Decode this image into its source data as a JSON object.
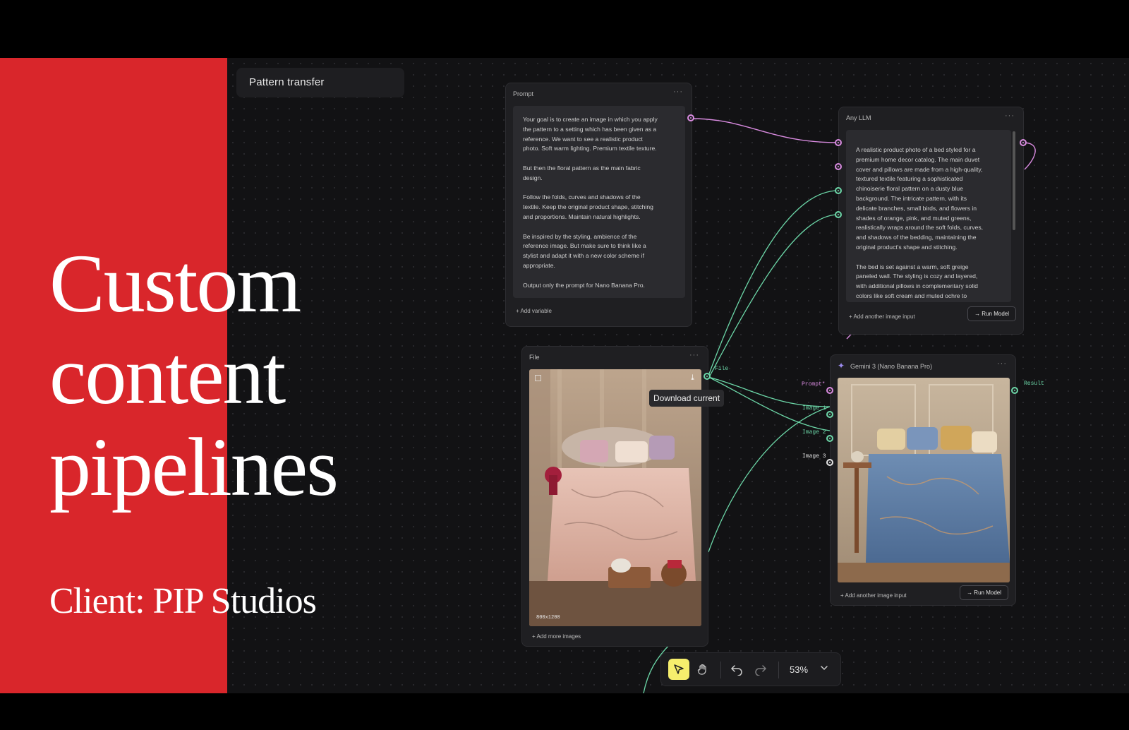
{
  "slide": {
    "headline": "Custom\ncontent\npipelines",
    "client": "Client: PIP Studios"
  },
  "workflow_title": "Pattern transfer",
  "prompt_node": {
    "title": "Prompt",
    "menu": "···",
    "text": "Your goal is to create an image in which you apply\nthe pattern to a setting which has been given as a\nreference. We want to see a realistic product\nphoto. Soft warm lighting. Premium textile texture.\n\nBut then the  floral pattern as the main fabric\ndesign.\n\nFollow the folds, curves and shadows of the\ntextile. Keep the original product shape, stitching\nand proportions. Maintain natural highlights.\n\nBe inspired by the styling, ambience of the\nreference image. But make sure to think like a\nstylist and adapt it with a new color scheme if\nappropriate.\n\nOutput only the prompt for Nano Banana Pro.",
    "footer": "+ Add variable"
  },
  "llm_node": {
    "title": "Any LLM",
    "menu": "···",
    "text": "A realistic product photo of a bed styled for a\npremium home decor catalog. The main duvet\ncover and pillows are made from a high-quality,\ntextured textile featuring a sophisticated\nchinoiserie floral pattern on a dusty blue\nbackground. The intricate pattern, with its\ndelicate branches, small birds, and flowers in\nshades of orange, pink, and muted greens,\nrealistically wraps around the soft folds, curves,\nand shadows of the bedding, maintaining the\noriginal product's shape and stitching.\n\nThe bed is set against a warm, soft greige\npaneled wall. The styling is cozy and layered,\nwith additional pillows in complementary solid\ncolors like soft cream and muted ochre to",
    "footer": "+ Add another image input",
    "run_label": "→ Run Model"
  },
  "file_node": {
    "title": "File",
    "menu": "···",
    "image_size": "800x1200",
    "footer": "+ Add more images",
    "port_label": "File",
    "tooltip": "Download current"
  },
  "gemini_node": {
    "title": "Gemini 3 (Nano Banana Pro)",
    "menu": "···",
    "footer": "+ Add another image input",
    "run_label": "→ Run Model",
    "inputs": [
      "Prompt*",
      "Image 1",
      "Image 2",
      "Image 3"
    ],
    "output": "Result"
  },
  "toolbar": {
    "zoom": "53%",
    "icons": [
      "pointer-icon",
      "hand-icon",
      "undo-icon",
      "redo-icon",
      "chevron-down-icon"
    ]
  },
  "colors": {
    "slide_red": "#d9262b",
    "canvas": "#121214",
    "node_bg": "#1f1f22",
    "wire_pink": "#d98be0",
    "wire_green": "#6cd7a8",
    "active_tool": "#f6ee6d"
  }
}
